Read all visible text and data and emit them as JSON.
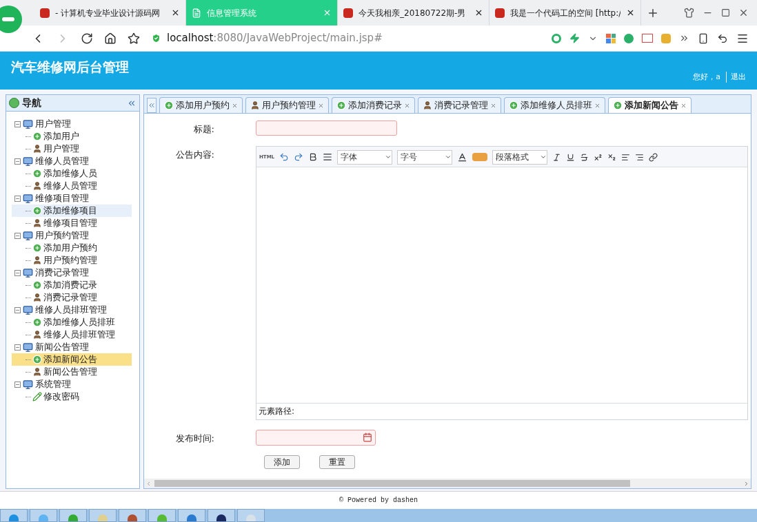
{
  "browser": {
    "tabs": [
      {
        "title": "- 计算机专业毕业设计源码网",
        "selected": false
      },
      {
        "title": "信息管理系统",
        "selected": true
      },
      {
        "title": "今天我相亲_20180722期-男",
        "selected": false
      },
      {
        "title": "我是一个代码工的空间 [http:/",
        "selected": false
      }
    ],
    "url_host": "localhost",
    "url_rest": ":8080/JavaWebProject/main.jsp#"
  },
  "header": {
    "title": "汽车维修网后台管理",
    "greeting": "您好，a",
    "logout": "退出"
  },
  "nav": {
    "title": "导航",
    "groups": [
      {
        "label": "用户管理",
        "expanded": true,
        "children": [
          {
            "label": "添加用户",
            "kind": "add",
            "selected": false,
            "hovered": false
          },
          {
            "label": "用户管理",
            "kind": "manage",
            "selected": false,
            "hovered": false
          }
        ]
      },
      {
        "label": "维修人员管理",
        "expanded": true,
        "children": [
          {
            "label": "添加维修人员",
            "kind": "add",
            "selected": false,
            "hovered": false
          },
          {
            "label": "维修人员管理",
            "kind": "manage",
            "selected": false,
            "hovered": false
          }
        ]
      },
      {
        "label": "维修项目管理",
        "expanded": true,
        "children": [
          {
            "label": "添加维修项目",
            "kind": "add",
            "selected": false,
            "hovered": true
          },
          {
            "label": "维修项目管理",
            "kind": "manage",
            "selected": false,
            "hovered": false
          }
        ]
      },
      {
        "label": "用户预约管理",
        "expanded": true,
        "children": [
          {
            "label": "添加用户预约",
            "kind": "add",
            "selected": false,
            "hovered": false
          },
          {
            "label": "用户预约管理",
            "kind": "manage",
            "selected": false,
            "hovered": false
          }
        ]
      },
      {
        "label": "消费记录管理",
        "expanded": true,
        "children": [
          {
            "label": "添加消费记录",
            "kind": "add",
            "selected": false,
            "hovered": false
          },
          {
            "label": "消费记录管理",
            "kind": "manage",
            "selected": false,
            "hovered": false
          }
        ]
      },
      {
        "label": "维修人员排班管理",
        "expanded": true,
        "children": [
          {
            "label": "添加维修人员排班",
            "kind": "add",
            "selected": false,
            "hovered": false
          },
          {
            "label": "维修人员排班管理",
            "kind": "manage",
            "selected": false,
            "hovered": false
          }
        ]
      },
      {
        "label": "新闻公告管理",
        "expanded": true,
        "children": [
          {
            "label": "添加新闻公告",
            "kind": "add",
            "selected": true,
            "hovered": false
          },
          {
            "label": "新闻公告管理",
            "kind": "manage",
            "selected": false,
            "hovered": false
          }
        ]
      },
      {
        "label": "系统管理",
        "expanded": true,
        "children": [
          {
            "label": "修改密码",
            "kind": "edit",
            "selected": false,
            "hovered": false
          }
        ]
      }
    ]
  },
  "tabs": [
    {
      "label": "添加用户预约",
      "kind": "add",
      "selected": false
    },
    {
      "label": "用户预约管理",
      "kind": "manage",
      "selected": false
    },
    {
      "label": "添加消费记录",
      "kind": "add",
      "selected": false
    },
    {
      "label": "消费记录管理",
      "kind": "manage",
      "selected": false
    },
    {
      "label": "添加维修人员排班",
      "kind": "add",
      "selected": false
    },
    {
      "label": "添加新闻公告",
      "kind": "add",
      "selected": true
    }
  ],
  "form": {
    "fields": [
      {
        "label": "标题:",
        "kind": "text"
      },
      {
        "label": "公告内容:",
        "kind": "editor"
      },
      {
        "label": "发布时间:",
        "kind": "date"
      }
    ],
    "editor": {
      "html": "HTML",
      "font": "字体",
      "size": "字号",
      "paragraph": "段落格式",
      "path": "元素路径:"
    },
    "buttons": [
      "添加",
      "重置"
    ]
  },
  "footer": "© Powered by dashen"
}
